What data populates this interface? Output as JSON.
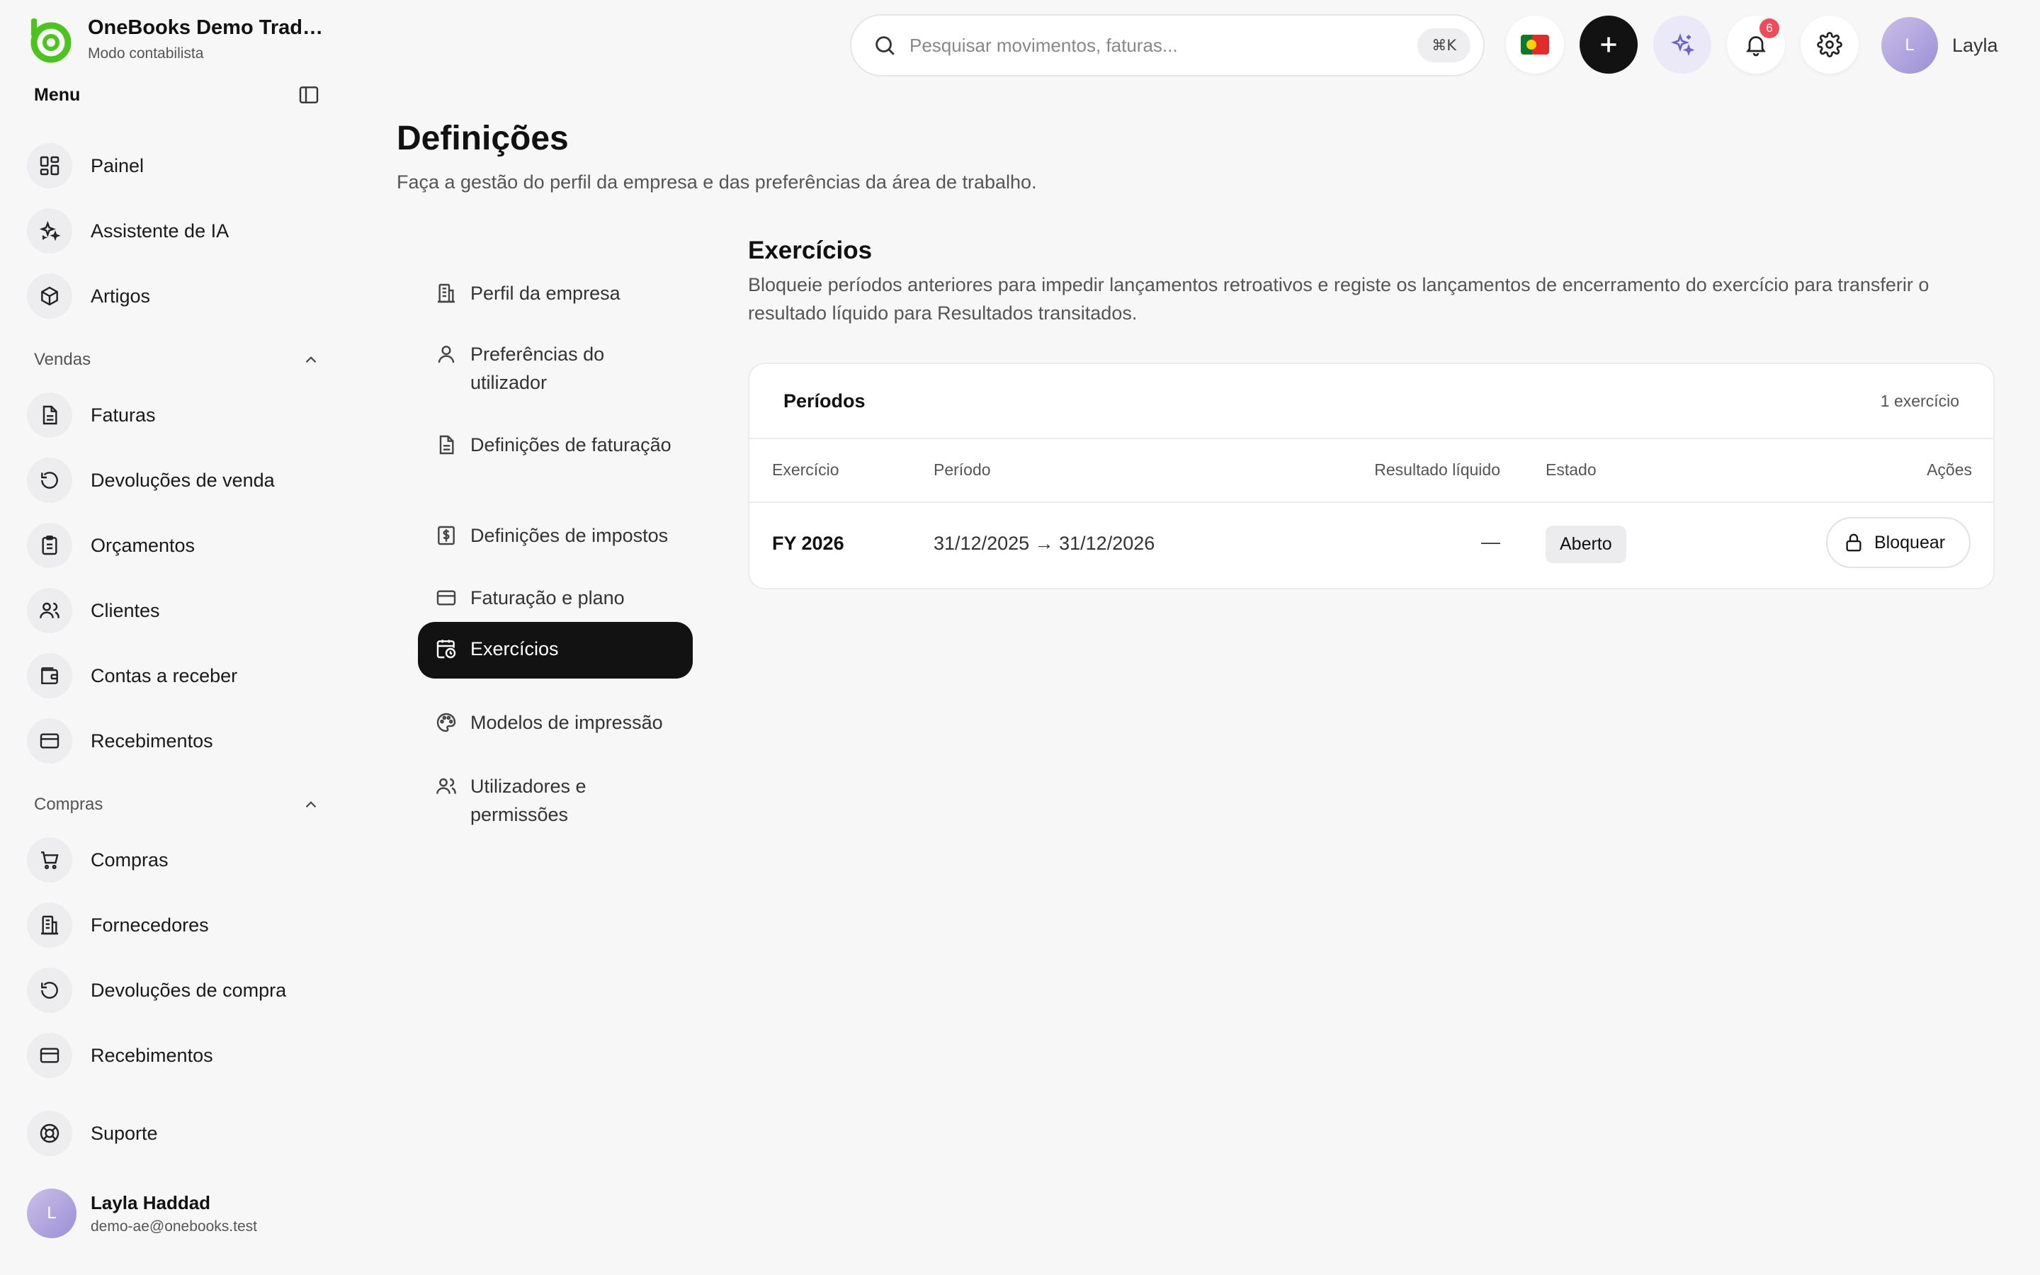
{
  "brand": {
    "name": "OneBooks Demo Tradin...",
    "subtitle": "Modo contabilista",
    "color": "#4cc41e"
  },
  "sidebar": {
    "menu_label": "Menu",
    "items_top": [
      {
        "label": "Painel",
        "icon": "dashboard-icon"
      },
      {
        "label": "Assistente de IA",
        "icon": "sparkles-icon"
      },
      {
        "label": "Artigos",
        "icon": "box-icon"
      }
    ],
    "sales": {
      "title": "Vendas",
      "items": [
        {
          "label": "Faturas",
          "icon": "invoice-icon"
        },
        {
          "label": "Devoluções de venda",
          "icon": "return-icon"
        },
        {
          "label": "Orçamentos",
          "icon": "clipboard-icon"
        },
        {
          "label": "Clientes",
          "icon": "users-icon"
        },
        {
          "label": "Contas a receber",
          "icon": "wallet-icon"
        },
        {
          "label": "Recebimentos",
          "icon": "card-icon"
        }
      ]
    },
    "purchases": {
      "title": "Compras",
      "items": [
        {
          "label": "Compras",
          "icon": "cart-icon"
        },
        {
          "label": "Fornecedores",
          "icon": "building-icon"
        },
        {
          "label": "Devoluções de compra",
          "icon": "return-icon"
        },
        {
          "label": "Recebimentos",
          "icon": "card-icon"
        }
      ]
    },
    "support_label": "Suporte",
    "user": {
      "initial": "L",
      "name": "Layla Haddad",
      "email": "demo-ae@onebooks.test"
    }
  },
  "topbar": {
    "search_placeholder": "Pesquisar movimentos, faturas...",
    "search_shortcut": "⌘K",
    "notifications_count": "6",
    "user_initial": "L",
    "user_name": "Layla"
  },
  "page": {
    "title": "Definições",
    "subtitle": "Faça a gestão do perfil da empresa e das preferências da área de trabalho."
  },
  "settings_nav": [
    {
      "label": "Perfil da empresa",
      "icon": "building-icon"
    },
    {
      "label": "Preferências do utilizador",
      "icon": "user-icon"
    },
    {
      "label": "Definições de faturação",
      "icon": "document-icon"
    },
    {
      "label": "Definições de impostos",
      "icon": "tax-icon"
    },
    {
      "label": "Faturação e plano",
      "icon": "credit-card-icon"
    },
    {
      "label": "Exercícios",
      "icon": "calendar-clock-icon",
      "active": true
    },
    {
      "label": "Modelos de impressão",
      "icon": "palette-icon"
    },
    {
      "label": "Utilizadores e permissões",
      "icon": "users-icon"
    }
  ],
  "exercicios": {
    "title": "Exercícios",
    "description": "Bloqueie períodos anteriores para impedir lançamentos retroativos e registe os lançamentos de encerramento do exercício para transferir o resultado líquido para Resultados transitados.",
    "card": {
      "title": "Períodos",
      "count": "1 exercício",
      "columns": {
        "exercicio": "Exercício",
        "periodo": "Período",
        "resultado": "Resultado líquido",
        "estado": "Estado",
        "acoes": "Ações"
      },
      "rows": [
        {
          "exercicio": "FY 2026",
          "periodo": "31/12/2025 → 31/12/2026",
          "resultado": "—",
          "estado": "Aberto",
          "acao": "Bloquear"
        }
      ]
    }
  }
}
